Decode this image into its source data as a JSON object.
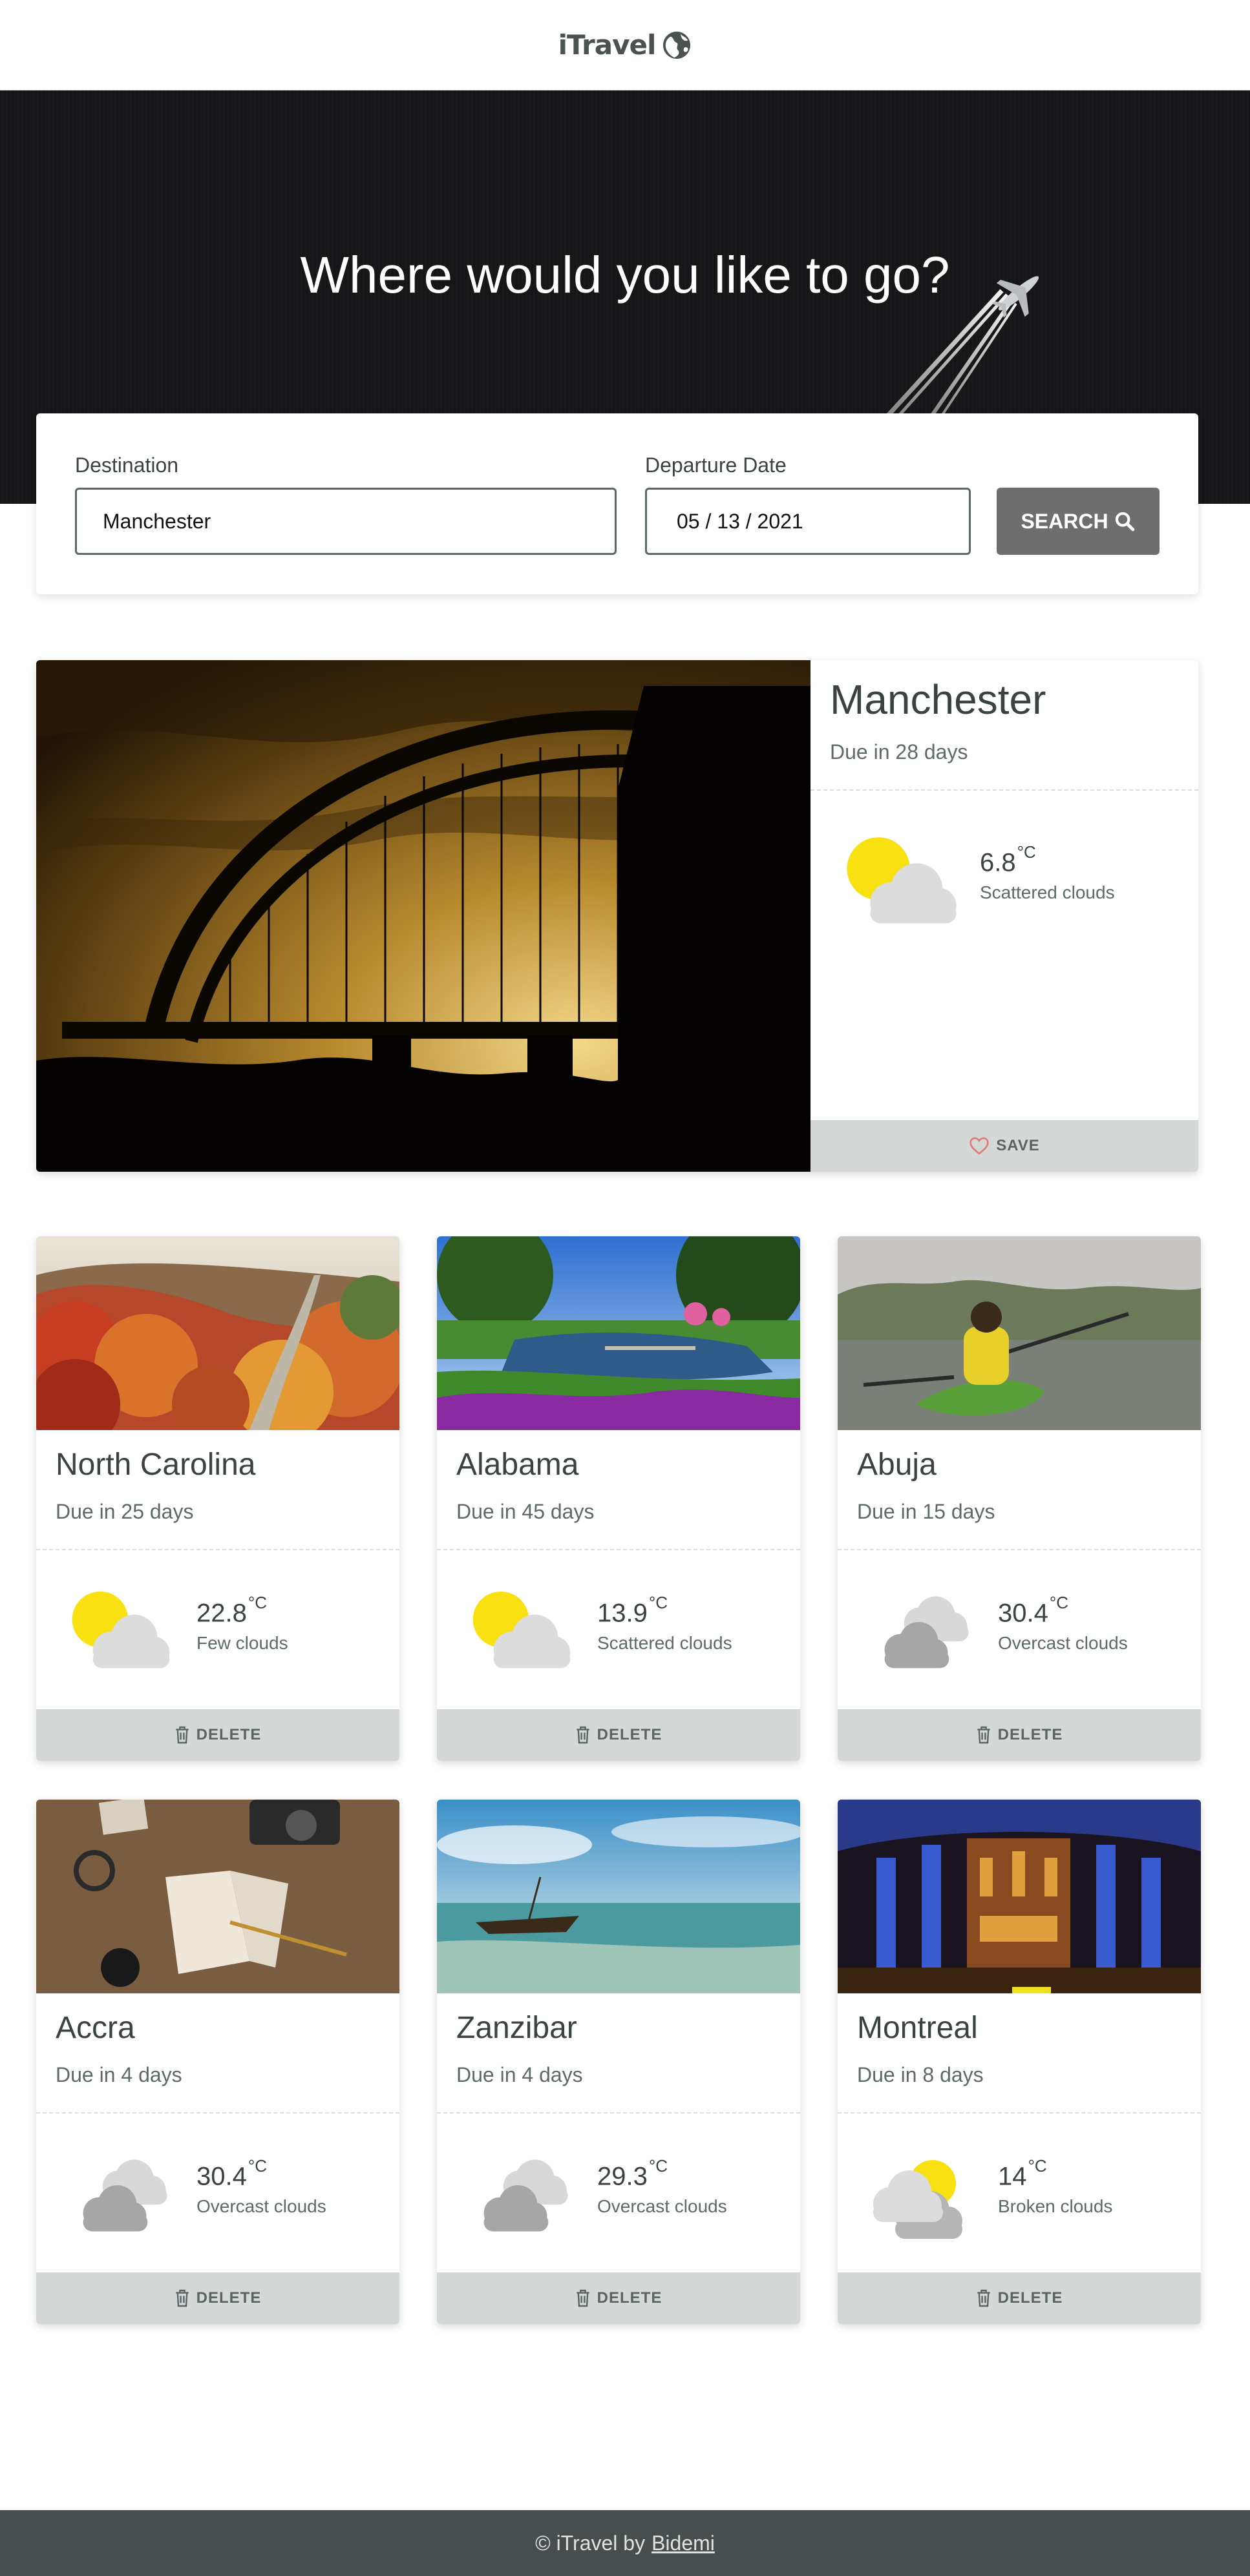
{
  "header": {
    "logo_text": "iTravel",
    "logo_icon": "globe-icon"
  },
  "hero": {
    "title": "Where would you like to go?"
  },
  "search": {
    "destination_label": "Destination",
    "destination_value": "Manchester",
    "date_label": "Departure Date",
    "date_value": "05 / 13 / 2021",
    "button_label": "SEARCH",
    "button_icon": "search-icon"
  },
  "featured": {
    "name": "Manchester",
    "due": "Due in 28 days",
    "temp": "6.8",
    "unit": "°C",
    "description": "Scattered clouds",
    "weather_icon": "sun-cloud-icon",
    "button_label": "SAVE",
    "button_icon": "heart-icon"
  },
  "trips": [
    {
      "name": "North Carolina",
      "due": "Due in 25 days",
      "temp": "22.8",
      "unit": "°C",
      "description": "Few clouds",
      "weather_icon": "sun-cloud-icon",
      "button_label": "DELETE"
    },
    {
      "name": "Alabama",
      "due": "Due in 45 days",
      "temp": "13.9",
      "unit": "°C",
      "description": "Scattered clouds",
      "weather_icon": "sun-cloud-icon",
      "button_label": "DELETE"
    },
    {
      "name": "Abuja",
      "due": "Due in 15 days",
      "temp": "30.4",
      "unit": "°C",
      "description": "Overcast clouds",
      "weather_icon": "overcast-icon",
      "button_label": "DELETE"
    },
    {
      "name": "Accra",
      "due": "Due in 4 days",
      "temp": "30.4",
      "unit": "°C",
      "description": "Overcast clouds",
      "weather_icon": "overcast-icon",
      "button_label": "DELETE"
    },
    {
      "name": "Zanzibar",
      "due": "Due in 4 days",
      "temp": "29.3",
      "unit": "°C",
      "description": "Overcast clouds",
      "weather_icon": "overcast-icon",
      "button_label": "DELETE"
    },
    {
      "name": "Montreal",
      "due": "Due in 8 days",
      "temp": "14",
      "unit": "°C",
      "description": "Broken clouds",
      "weather_icon": "broken-clouds-icon",
      "button_label": "DELETE"
    }
  ],
  "footer": {
    "prefix": "© iTravel by",
    "link_text": "Bidemi"
  },
  "colors": {
    "accent_button": "#6e6e6e",
    "card_footer": "#d4d9d8",
    "page_footer": "#474e4d",
    "sun": "#f9e010"
  }
}
